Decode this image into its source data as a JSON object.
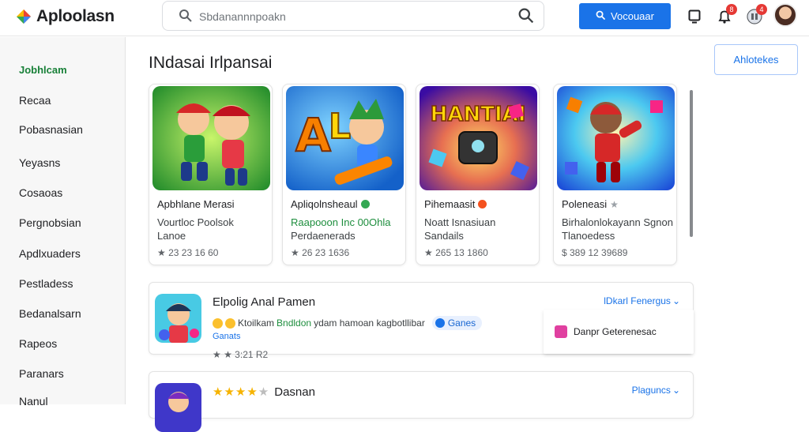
{
  "header": {
    "app_title": "Aploolasn",
    "search_placeholder": "Sbdanannnpoakn",
    "voice_button": "Vocouaar",
    "notif_badge_1": "8",
    "notif_badge_2": "4"
  },
  "sidebar": {
    "items": [
      {
        "label": "Jobhlcam",
        "active": true
      },
      {
        "label": "Recaa"
      },
      {
        "label": "Pobasnasian"
      },
      {
        "label": "Yeyasns"
      },
      {
        "label": "Cosaoas"
      },
      {
        "label": "Pergnobsian"
      },
      {
        "label": "Apdlxuaders"
      },
      {
        "label": "Pestladess"
      },
      {
        "label": "Bedanalsarn"
      },
      {
        "label": "Rapeos"
      },
      {
        "label": "Paranars"
      },
      {
        "label": "Nanul"
      }
    ]
  },
  "main": {
    "title": "INdasai Irlpansai",
    "filter_button": "Ahlotekes",
    "cards": [
      {
        "name": "Apbhlane Merasi",
        "desc1": "Vourtloc Poolsok",
        "desc2": "Lanoe",
        "meta": "★ 23 23 16 60",
        "art": "green"
      },
      {
        "name": "Apliqolnsheaul",
        "desc1": "Raapooon Inc 00Ohla",
        "desc2": "Perdaenerads",
        "meta": "★ 26 23 1636",
        "art": "blue",
        "desc1_green": true
      },
      {
        "name": "Pihemaasit",
        "desc1": "Noatt Isnasiuan",
        "desc2": "Sandails",
        "meta": "★ 265 13 1860",
        "art": "purple",
        "art_text": "HANTIAI"
      },
      {
        "name": "Poleneasi",
        "desc1": "Birhalonlokayann Sgnon",
        "desc2": "Tlanoedess",
        "meta": "$ 389 12 39689",
        "art": "red"
      }
    ],
    "list": [
      {
        "title": "Elpolig Anal Pamen",
        "line_pre": "Ktoilkam",
        "line_hl": "Bndldon",
        "line_post": "ydam hamoan kagbotllibar",
        "chip": "Ganes",
        "sub": "Ganats",
        "meta": "★ ★ 3:21 R2",
        "link": "lDkarl Fenergus"
      },
      {
        "title": "Dasnan",
        "rating": 4,
        "link": "Plaguncs"
      }
    ],
    "dropdown_item": "Danpr Geterenesac"
  },
  "colors": {
    "accent": "#1a73e8",
    "active_green": "#188038",
    "badge_red": "#e53935"
  },
  "icons": [
    "logo-icon",
    "search-icon",
    "mic-icon",
    "tablet-icon",
    "bell-icon",
    "apps-icon",
    "star-icon",
    "chevron-down-icon"
  ]
}
